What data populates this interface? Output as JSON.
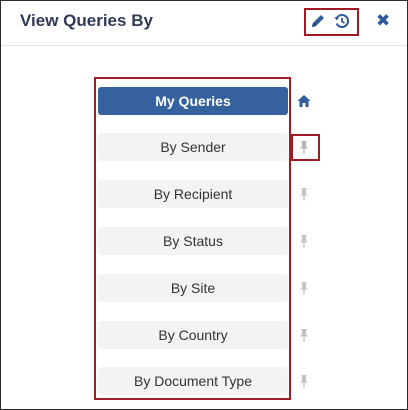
{
  "dialog": {
    "title": "View Queries By",
    "icons": {
      "edit": "pencil-icon",
      "history": "history-icon",
      "close": "close-icon"
    },
    "close_glyph": "✖"
  },
  "items": [
    {
      "label": "My Queries",
      "active": true,
      "side_icon": "home-icon"
    },
    {
      "label": "By Sender",
      "active": false,
      "side_icon": "pin-icon"
    },
    {
      "label": "By Recipient",
      "active": false,
      "side_icon": "pin-icon"
    },
    {
      "label": "By Status",
      "active": false,
      "side_icon": "pin-icon"
    },
    {
      "label": "By Site",
      "active": false,
      "side_icon": "pin-icon"
    },
    {
      "label": "By Country",
      "active": false,
      "side_icon": "pin-icon"
    },
    {
      "label": "By Document Type",
      "active": false,
      "side_icon": "pin-icon"
    }
  ],
  "colors": {
    "accent": "#35619e",
    "title": "#2f3a56",
    "highlight_border": "#a01b23",
    "pin_inactive": "#c4c4c4",
    "pin_emphasis": "#b5b5b5"
  }
}
